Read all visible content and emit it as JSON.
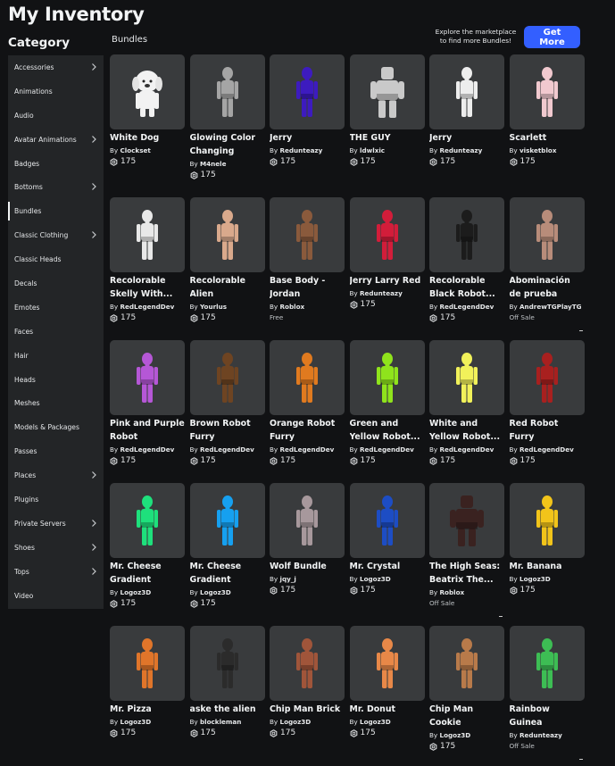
{
  "page": {
    "title": "My Inventory",
    "category_heading": "Category",
    "section": "Bundles"
  },
  "promo": {
    "line1": "Explore the marketplace",
    "line2": "to find more Bundles!",
    "button": "Get More"
  },
  "sidebar": [
    {
      "label": "Accessories",
      "chevron": true
    },
    {
      "label": "Animations",
      "chevron": false
    },
    {
      "label": "Audio",
      "chevron": false
    },
    {
      "label": "Avatar Animations",
      "chevron": true
    },
    {
      "label": "Badges",
      "chevron": false
    },
    {
      "label": "Bottoms",
      "chevron": true
    },
    {
      "label": "Bundles",
      "chevron": false,
      "active": true
    },
    {
      "label": "Classic Clothing",
      "chevron": true
    },
    {
      "label": "Classic Heads",
      "chevron": false
    },
    {
      "label": "Decals",
      "chevron": false
    },
    {
      "label": "Emotes",
      "chevron": false
    },
    {
      "label": "Faces",
      "chevron": false
    },
    {
      "label": "Hair",
      "chevron": false
    },
    {
      "label": "Heads",
      "chevron": false
    },
    {
      "label": "Meshes",
      "chevron": false
    },
    {
      "label": "Models & Packages",
      "chevron": false
    },
    {
      "label": "Passes",
      "chevron": false
    },
    {
      "label": "Places",
      "chevron": true
    },
    {
      "label": "Plugins",
      "chevron": false
    },
    {
      "label": "Private Servers",
      "chevron": true
    },
    {
      "label": "Shoes",
      "chevron": true
    },
    {
      "label": "Tops",
      "chevron": true
    },
    {
      "label": "Video",
      "chevron": false
    }
  ],
  "items": [
    {
      "name": "White Dog",
      "by": "By",
      "creator": "Clockset",
      "price": "175",
      "color": "#f2f2f2",
      "kind": "dog"
    },
    {
      "name": "Glowing Color Changing",
      "by": "By",
      "creator": "M4nele",
      "price": "175",
      "color": "#a5a5a5",
      "kind": "body"
    },
    {
      "name": "Jerry",
      "by": "By",
      "creator": "Redunteazy",
      "price": "175",
      "color": "#3d1bbf",
      "kind": "body"
    },
    {
      "name": "THE GUY",
      "by": "By",
      "creator": "ldwlxic",
      "price": "175",
      "color": "#c9c9c9",
      "kind": "bulky"
    },
    {
      "name": "Jerry",
      "by": "By",
      "creator": "Redunteazy",
      "price": "175",
      "color": "#ededed",
      "kind": "body"
    },
    {
      "name": "Scarlett",
      "by": "By",
      "creator": "visketblox",
      "price": "175",
      "color": "#f1c9cf",
      "kind": "body"
    },
    {
      "name": "Recolorable Skelly With...",
      "by": "By",
      "creator": "RedLegendDev",
      "price": "175",
      "color": "#e8e8e8",
      "kind": "body"
    },
    {
      "name": "Recolorable Alien",
      "by": "By",
      "creator": "Yourlus",
      "price": "175",
      "color": "#d9a98c",
      "kind": "body"
    },
    {
      "name": "Base Body - Jordan",
      "by": "By",
      "creator": "Roblox",
      "status": "Free",
      "color": "#8a5a3c",
      "kind": "body"
    },
    {
      "name": "Jerry Larry Red",
      "by": "By",
      "creator": "Redunteazy",
      "price": "175",
      "color": "#d21d3a",
      "kind": "body"
    },
    {
      "name": "Recolorable Black Robot...",
      "by": "By",
      "creator": "RedLegendDev",
      "price": "175",
      "color": "#1c1c1c",
      "kind": "body"
    },
    {
      "name": "Abominación de prueba",
      "by": "By",
      "creator": "AndrewTGPlayTG",
      "status": "Off Sale",
      "color": "#b88c7a",
      "kind": "body"
    },
    {
      "name": "Pink and Purple Robot",
      "by": "By",
      "creator": "RedLegendDev",
      "price": "175",
      "color": "#b557d6",
      "kind": "body"
    },
    {
      "name": "Brown Robot Furry",
      "by": "By",
      "creator": "RedLegendDev",
      "price": "175",
      "color": "#6e4422",
      "kind": "body"
    },
    {
      "name": "Orange Robot Furry",
      "by": "By",
      "creator": "RedLegendDev",
      "price": "175",
      "color": "#e07a1f",
      "kind": "body"
    },
    {
      "name": "Green and Yellow Robot...",
      "by": "By",
      "creator": "RedLegendDev",
      "price": "175",
      "color": "#8fe31c",
      "kind": "body"
    },
    {
      "name": "White and Yellow Robot...",
      "by": "By",
      "creator": "RedLegendDev",
      "price": "175",
      "color": "#f1f15a",
      "kind": "body"
    },
    {
      "name": "Red Robot Furry",
      "by": "By",
      "creator": "RedLegendDev",
      "price": "175",
      "color": "#a8201f",
      "kind": "body"
    },
    {
      "name": "Mr. Cheese Gradient",
      "by": "By",
      "creator": "Logoz3D",
      "price": "175",
      "color": "#1ee07c",
      "kind": "body"
    },
    {
      "name": "Mr. Cheese Gradient",
      "by": "By",
      "creator": "Logoz3D",
      "price": "175",
      "color": "#16a0f0",
      "kind": "body"
    },
    {
      "name": "Wolf Bundle",
      "by": "By",
      "creator": "jqy_j",
      "price": "175",
      "color": "#a7989c",
      "kind": "body"
    },
    {
      "name": "Mr. Crystal",
      "by": "By",
      "creator": "Logoz3D",
      "price": "175",
      "color": "#1d4dc4",
      "kind": "body"
    },
    {
      "name": "The High Seas: Beatrix The...",
      "by": "By",
      "creator": "Roblox",
      "status": "Off Sale",
      "color": "#3a2220",
      "kind": "bulky"
    },
    {
      "name": "Mr. Banana",
      "by": "By",
      "creator": "Logoz3D",
      "price": "175",
      "color": "#f2c41a",
      "kind": "body"
    },
    {
      "name": "Mr. Pizza",
      "by": "By",
      "creator": "Logoz3D",
      "price": "175",
      "color": "#e0752a",
      "kind": "body"
    },
    {
      "name": "aske the alien",
      "by": "By",
      "creator": "blockleman",
      "price": "175",
      "color": "#2b2b2b",
      "kind": "body"
    },
    {
      "name": "Chip Man Brick",
      "by": "By",
      "creator": "Logoz3D",
      "price": "175",
      "color": "#a0553a",
      "kind": "body"
    },
    {
      "name": "Mr. Donut",
      "by": "By",
      "creator": "Logoz3D",
      "price": "175",
      "color": "#e88848",
      "kind": "body"
    },
    {
      "name": "Chip Man Cookie",
      "by": "By",
      "creator": "Logoz3D",
      "price": "175",
      "color": "#b87a4a",
      "kind": "body"
    },
    {
      "name": "Rainbow Guinea",
      "by": "By",
      "creator": "Redunteazy",
      "status": "Off Sale",
      "color": "#3dbd54",
      "kind": "body"
    }
  ],
  "colors": {
    "accent": "#335fff",
    "background": "#111214",
    "panel": "#232527",
    "thumb": "#393b3d"
  }
}
